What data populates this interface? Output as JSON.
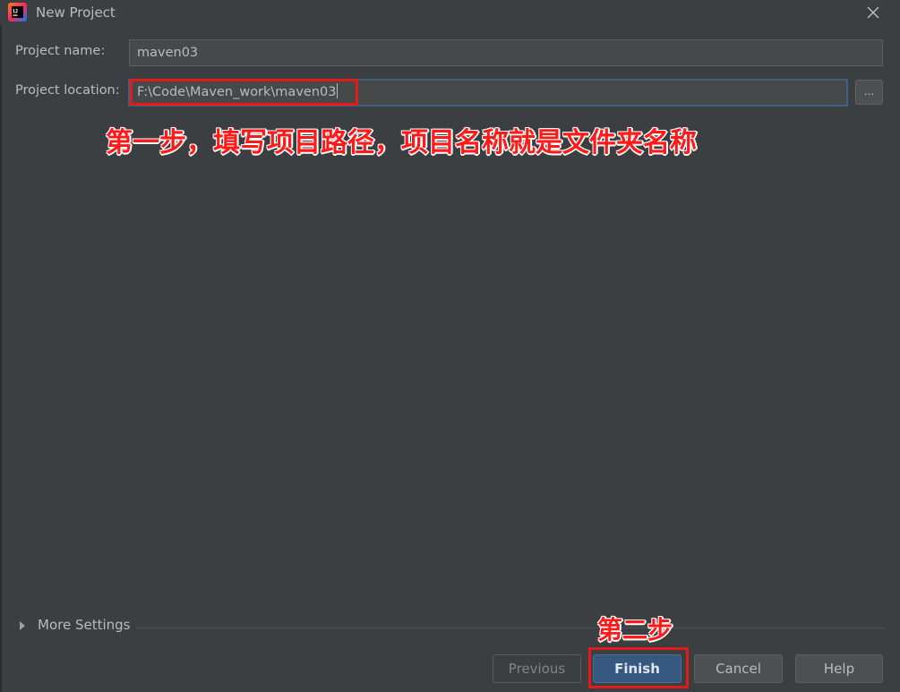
{
  "window": {
    "title": "New Project",
    "app_icon": "intellij-idea-icon",
    "close_icon": "close-icon"
  },
  "form": {
    "project_name_label": "Project name:",
    "project_name_value": "maven03",
    "project_location_label": "Project location:",
    "project_location_value": "F:\\Code\\Maven_work\\maven03",
    "browse_label": "..."
  },
  "annotations": {
    "step1": "第一步，填写项目路径，项目名称就是文件夹名称",
    "step2": "第二步",
    "color": "#ff1a1a"
  },
  "more_settings": {
    "label": "More Settings",
    "icon": "expand-triangle-icon"
  },
  "buttons": {
    "previous": "Previous",
    "finish": "Finish",
    "cancel": "Cancel",
    "help": "Help"
  },
  "colors": {
    "background": "#3c3f41",
    "primary": "#365880",
    "focus": "#3d6185"
  }
}
